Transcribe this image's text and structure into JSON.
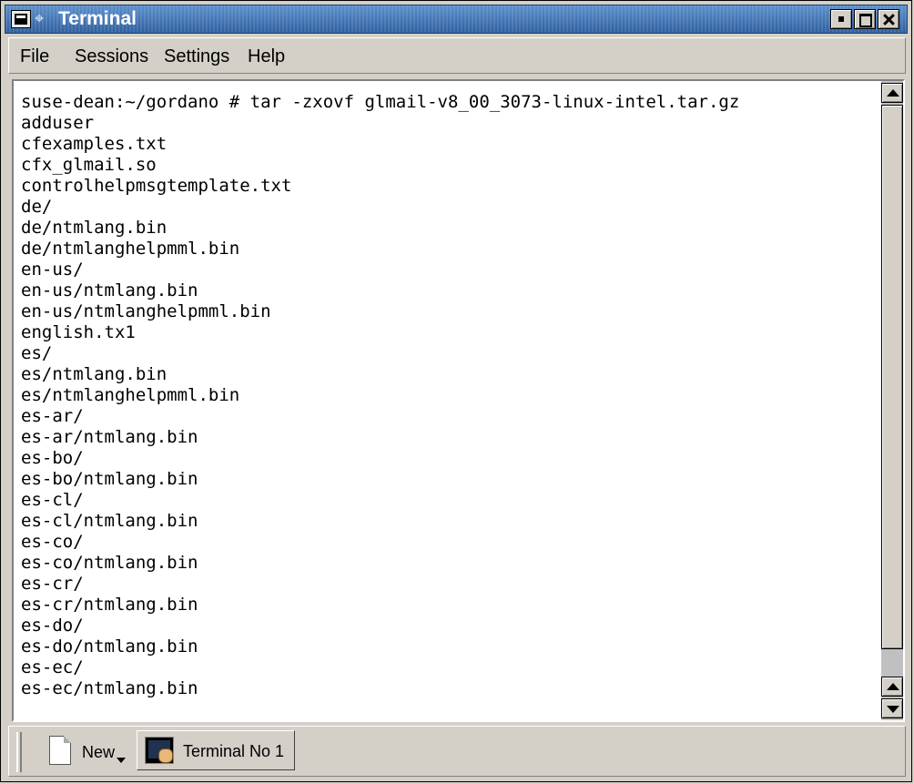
{
  "window": {
    "title": "Terminal"
  },
  "menubar": {
    "items": [
      "File",
      "Sessions",
      "Settings",
      "Help"
    ]
  },
  "terminal": {
    "lines": [
      "suse-dean:~/gordano # tar -zxovf glmail-v8_00_3073-linux-intel.tar.gz",
      "adduser",
      "cfexamples.txt",
      "cfx_glmail.so",
      "controlhelpmsgtemplate.txt",
      "de/",
      "de/ntmlang.bin",
      "de/ntmlanghelpmml.bin",
      "en-us/",
      "en-us/ntmlang.bin",
      "en-us/ntmlanghelpmml.bin",
      "english.tx1",
      "es/",
      "es/ntmlang.bin",
      "es/ntmlanghelpmml.bin",
      "es-ar/",
      "es-ar/ntmlang.bin",
      "es-bo/",
      "es-bo/ntmlang.bin",
      "es-cl/",
      "es-cl/ntmlang.bin",
      "es-co/",
      "es-co/ntmlang.bin",
      "es-cr/",
      "es-cr/ntmlang.bin",
      "es-do/",
      "es-do/ntmlang.bin",
      "es-ec/",
      "es-ec/ntmlang.bin"
    ]
  },
  "tabbar": {
    "new_label": "New",
    "session_tab_label": "Terminal No 1"
  },
  "icons": {
    "system_menu": "terminal-window-icon",
    "pin": "pin-icon",
    "minimize": "minimize-icon",
    "maximize": "maximize-icon",
    "close": "close-icon",
    "new_session": "new-page-icon",
    "session": "konsole-terminal-icon"
  },
  "colors": {
    "titlebar": "#3c6ea5",
    "chrome": "#d4d0c8",
    "terminal_bg": "#ffffff",
    "terminal_fg": "#000000"
  }
}
